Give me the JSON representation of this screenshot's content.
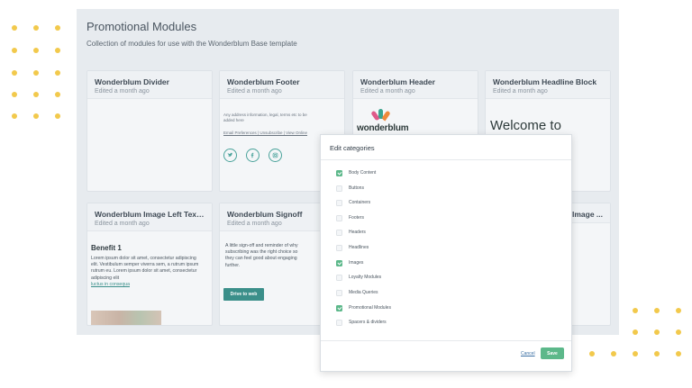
{
  "page": {
    "title": "Promotional Modules",
    "subtitle": "Collection of modules for use with the Wonderblum Base template"
  },
  "cards": [
    {
      "title": "Wonderblum Divider",
      "subtitle": "Edited a month ago"
    },
    {
      "title": "Wonderblum Footer",
      "subtitle": "Edited a month ago"
    },
    {
      "title": "Wonderblum Header",
      "subtitle": "Edited a month ago"
    },
    {
      "title": "Wonderblum Headline Block",
      "subtitle": "Edited a month ago"
    },
    {
      "title": "Wonderblum Image Left Text ...",
      "subtitle": "Edited a month ago"
    },
    {
      "title": "Wonderblum Signoff",
      "subtitle": "Edited a month ago"
    },
    {
      "title": "Image ..."
    }
  ],
  "footer_preview": {
    "address": "Any address information, legal, terms etc to be added here",
    "links": "Email Preferences | Unsubscribe | View Online"
  },
  "header_preview": {
    "logo_text": "wonderblum"
  },
  "headline_preview": {
    "text": "Welcome to"
  },
  "image_left_preview": {
    "heading": "Benefit 1",
    "body": "Lorem ipsum dolor sit amet, consectetur adipiscing elit. Vestibulum semper viverra sem, a rutrum ipsum rutrum eu. Lorem ipsum dolor sit amet, consectetur adipiscing elit",
    "link": "luctus in consequa"
  },
  "signoff_preview": {
    "body": "A little sign-off and reminder of why subscribing was the right choice so they can feel good about engaging further.",
    "button": "Drive to web"
  },
  "modal": {
    "title": "Edit categories",
    "categories": [
      {
        "label": "Body Content",
        "checked": true
      },
      {
        "label": "Buttons",
        "checked": false
      },
      {
        "label": "Containers",
        "checked": false
      },
      {
        "label": "Footers",
        "checked": false
      },
      {
        "label": "Headers",
        "checked": false
      },
      {
        "label": "Headlines",
        "checked": false
      },
      {
        "label": "Images",
        "checked": true
      },
      {
        "label": "Loyalty Modules",
        "checked": false
      },
      {
        "label": "Media Queries",
        "checked": false
      },
      {
        "label": "Promotional Modules",
        "checked": true
      },
      {
        "label": "Spacers & dividers",
        "checked": false
      }
    ],
    "cancel": "Cancel",
    "save": "Save"
  },
  "colors": {
    "accent_green": "#5cb88a",
    "teal": "#3b8f8a",
    "dot_yellow": "#f2c94c"
  }
}
